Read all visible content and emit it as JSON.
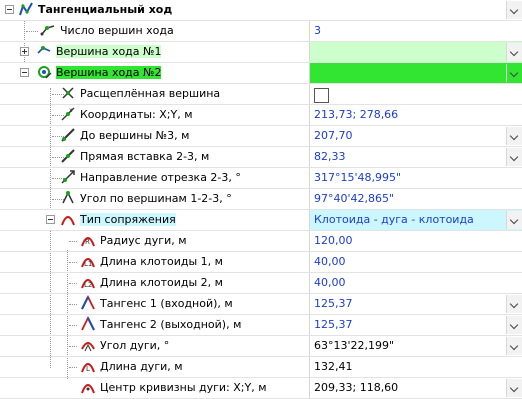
{
  "header": {
    "title": "Тангенциальный ход"
  },
  "rows": [
    {
      "label": "Число вершин хода",
      "value": "3"
    },
    {
      "label": "Вершина хода №1",
      "value": ""
    },
    {
      "label": "Вершина хода №2",
      "value": ""
    },
    {
      "label": "Расщеплённая вершина",
      "value": ""
    },
    {
      "label": "Координаты: X;Y, м",
      "value": "213,73; 278,66"
    },
    {
      "label": "До вершины №3, м",
      "value": "207,70"
    },
    {
      "label": "Прямая вставка 2-3, м",
      "value": "82,33"
    },
    {
      "label": "Направление отрезка 2-3, °",
      "value": "317°15'48,995\""
    },
    {
      "label": "Угол по вершинам 1-2-3, °",
      "value": "97°40'42,865\""
    },
    {
      "label": "Тип сопряжения",
      "value": "Клотоида - дуга - клотоида"
    },
    {
      "label": "Радиус дуги, м",
      "value": "120,00"
    },
    {
      "label": "Длина клотоиды 1, м",
      "value": "40,00"
    },
    {
      "label": "Длина клотоиды 2, м",
      "value": "40,00"
    },
    {
      "label": "Тангенс 1 (входной), м",
      "value": "125,37"
    },
    {
      "label": "Тангенс 2 (выходной), м",
      "value": "125,37"
    },
    {
      "label": "Угол дуги, °",
      "value": "63°13'22,199\""
    },
    {
      "label": "Длина дуги, м",
      "value": "132,41"
    },
    {
      "label": "Центр кривизны дуги: X;Y, м",
      "value": "209,33; 118,60"
    }
  ],
  "colors": {
    "value_text": "#1a3dd6",
    "highlight_green": "#33e533",
    "highlight_green_light": "#ccffcc",
    "highlight_blue": "#ccf7ff"
  }
}
